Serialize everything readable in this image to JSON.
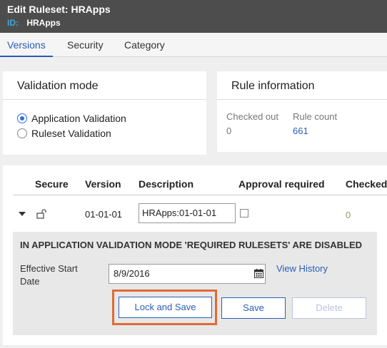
{
  "header": {
    "title": "Edit  Ruleset: HRApps",
    "id_label": "ID:",
    "id_value": "HRApps"
  },
  "tabs": [
    {
      "label": "Versions",
      "active": true
    },
    {
      "label": "Security",
      "active": false
    },
    {
      "label": "Category",
      "active": false
    }
  ],
  "validation": {
    "title": "Validation mode",
    "options": [
      {
        "label": "Application Validation",
        "selected": true
      },
      {
        "label": "Ruleset Validation",
        "selected": false
      }
    ]
  },
  "rule_info": {
    "title": "Rule information",
    "checked_out_label": "Checked out",
    "checked_out_value": "0",
    "rule_count_label": "Rule count",
    "rule_count_value": "661"
  },
  "versions_table": {
    "headers": [
      "Secure",
      "Version",
      "Description",
      "Approval required",
      "Checked"
    ],
    "rows": [
      {
        "version": "01-01-01",
        "description": "HRApps:01-01-01",
        "approval_required": false,
        "checked": "0"
      }
    ]
  },
  "detail": {
    "notice": "IN APPLICATION VALIDATION MODE 'REQUIRED RULESETS' ARE DISABLED",
    "effective_start_label": "Effective Start Date",
    "effective_start_value": "8/9/2016",
    "view_history": "View History",
    "lock_and_save": "Lock and Save",
    "save": "Save",
    "delete": "Delete"
  },
  "colors": {
    "accent": "#2a5db8",
    "highlight": "#e06a35",
    "header_bg": "#4d4d4d"
  }
}
